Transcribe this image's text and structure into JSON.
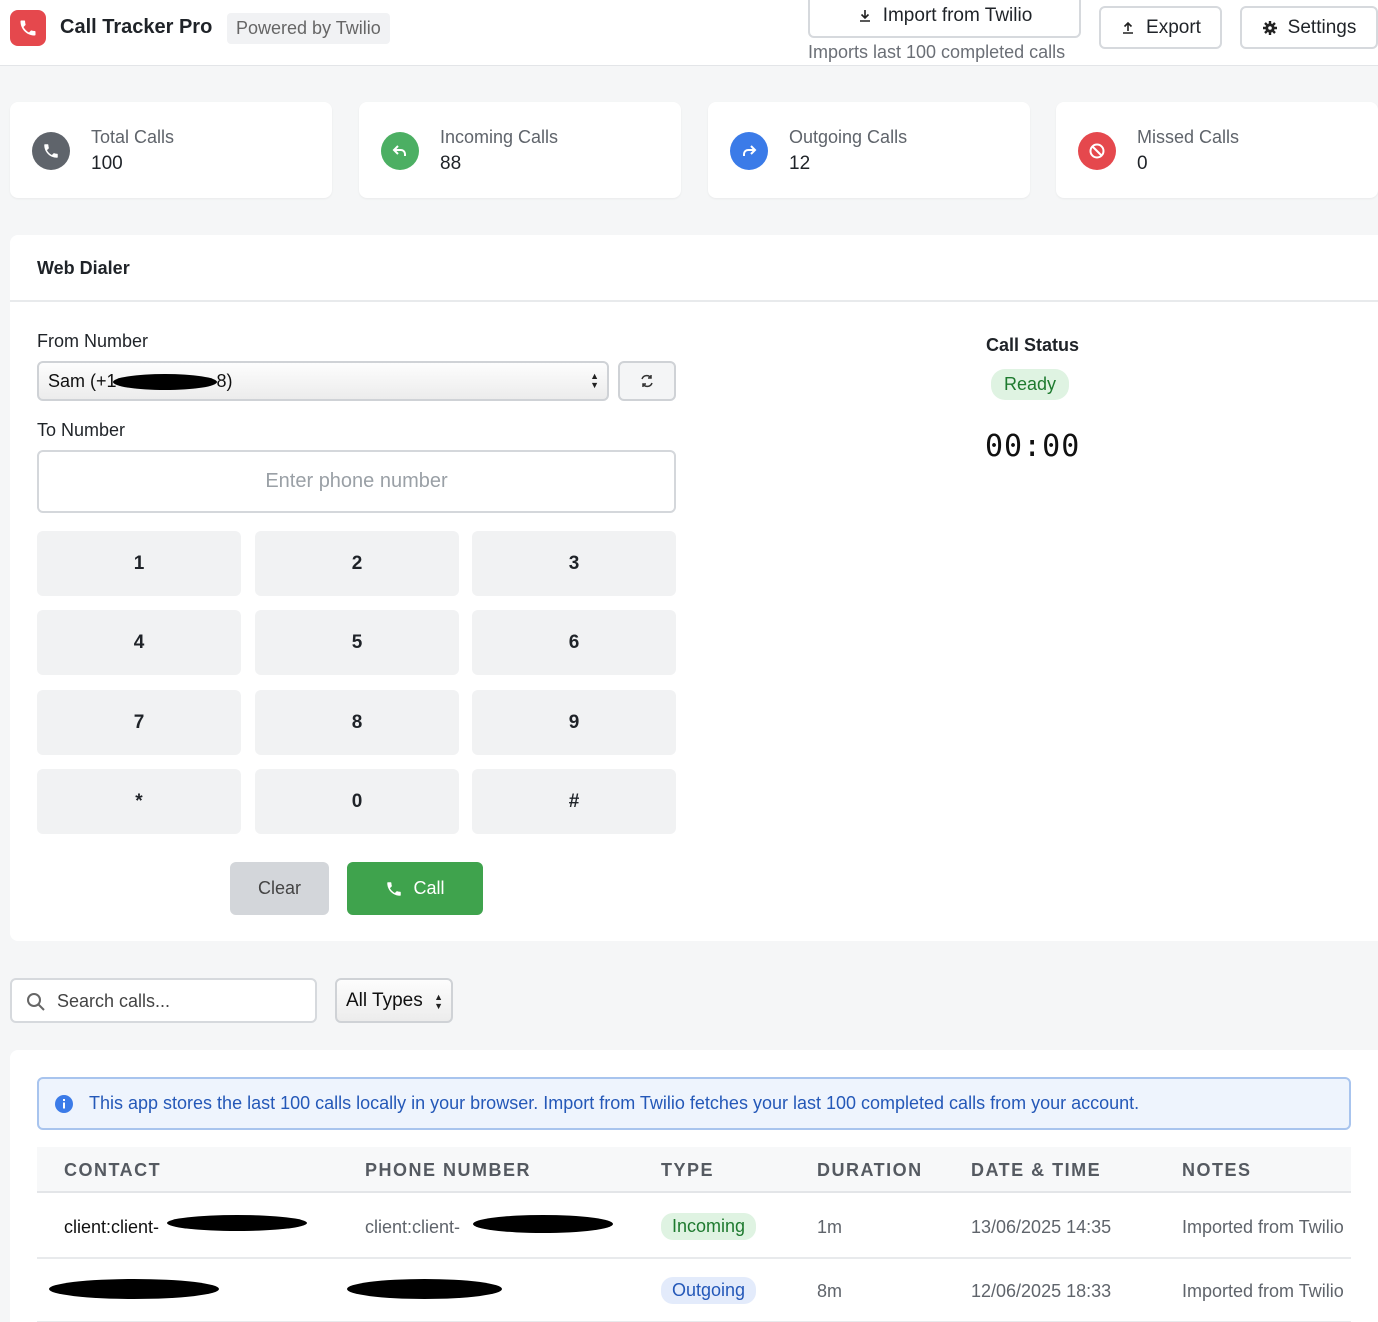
{
  "header": {
    "app_title": "Call Tracker Pro",
    "powered_by": "Powered by Twilio",
    "import_label": "Import from Twilio",
    "import_hint": "Imports last 100 completed calls",
    "export_label": "Export",
    "settings_label": "Settings"
  },
  "stats": [
    {
      "label": "Total Calls",
      "value": "100",
      "color": "#5f646b",
      "icon": "phone-icon"
    },
    {
      "label": "Incoming Calls",
      "value": "88",
      "color": "#4caf63",
      "icon": "incoming-arrow-icon"
    },
    {
      "label": "Outgoing Calls",
      "value": "12",
      "color": "#3b7be8",
      "icon": "outgoing-arrow-icon"
    },
    {
      "label": "Missed Calls",
      "value": "0",
      "color": "#e5484d",
      "icon": "ban-icon"
    }
  ],
  "dialer": {
    "title": "Web Dialer",
    "from_label": "From Number",
    "from_value_prefix": "Sam (+1",
    "from_value_suffix": "8)",
    "to_label": "To Number",
    "to_placeholder": "Enter phone number",
    "keys": [
      "1",
      "2",
      "3",
      "4",
      "5",
      "6",
      "7",
      "8",
      "9",
      "*",
      "0",
      "#"
    ],
    "clear_label": "Clear",
    "call_label": "Call",
    "status_label": "Call Status",
    "status_value": "Ready",
    "timer": "00:00"
  },
  "filters": {
    "search_placeholder": "Search calls...",
    "type_selected": "All Types"
  },
  "info_message": "This app stores the last 100 calls locally in your browser. Import from Twilio fetches your last 100 completed calls from your account.",
  "table": {
    "columns": [
      "CONTACT",
      "PHONE NUMBER",
      "TYPE",
      "DURATION",
      "DATE & TIME",
      "NOTES"
    ],
    "rows": [
      {
        "contact": "client:client-",
        "phone": "client:client-",
        "type": "Incoming",
        "duration": "1m",
        "datetime": "13/06/2025 14:35",
        "notes": "Imported from Twilio"
      },
      {
        "contact": "",
        "phone": "",
        "type": "Outgoing",
        "duration": "8m",
        "datetime": "12/06/2025 18:33",
        "notes": "Imported from Twilio"
      }
    ]
  }
}
